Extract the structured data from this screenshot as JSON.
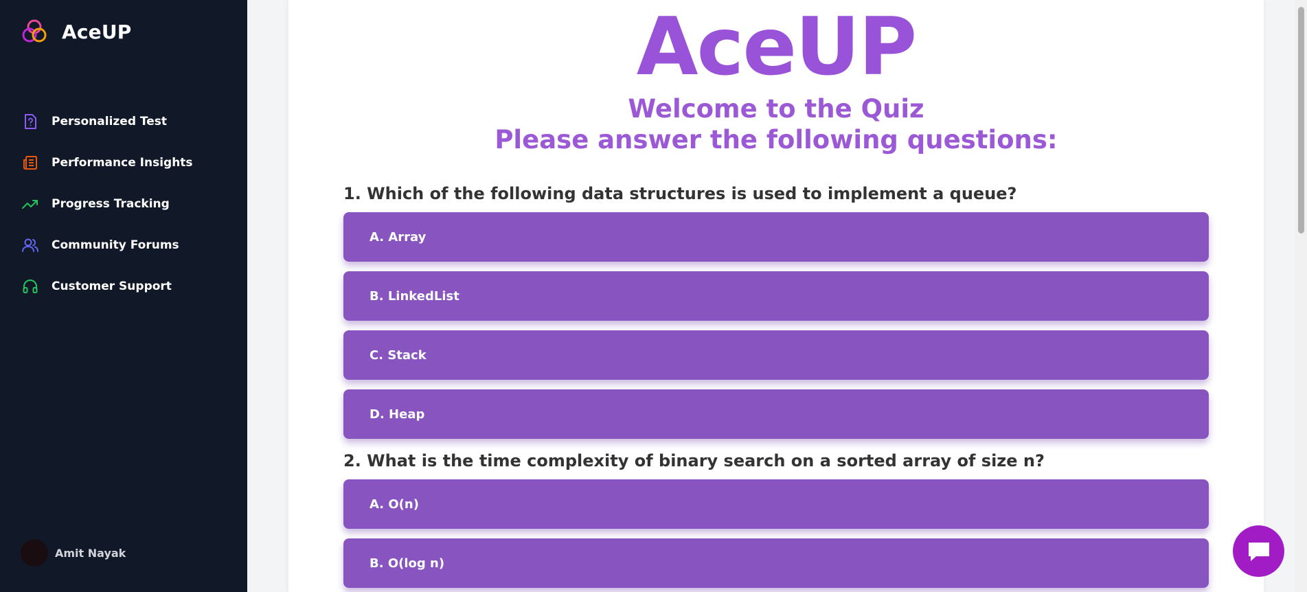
{
  "app": {
    "name": "AceUP"
  },
  "sidebar": {
    "items": [
      {
        "label": "Personalized Test",
        "icon": "question-file-icon",
        "color": "#8b5cf6"
      },
      {
        "label": "Performance Insights",
        "icon": "newspaper-icon",
        "color": "#ea580c"
      },
      {
        "label": "Progress Tracking",
        "icon": "trending-up-icon",
        "color": "#22c55e"
      },
      {
        "label": "Community Forums",
        "icon": "users-icon",
        "color": "#6366f1"
      },
      {
        "label": "Customer Support",
        "icon": "headset-icon",
        "color": "#22c55e"
      }
    ],
    "user": {
      "name": "Amit Nayak"
    }
  },
  "main": {
    "title": "AceUP",
    "subtitle1": "Welcome to the Quiz",
    "subtitle2": "Please answer the following questions:",
    "questions": [
      {
        "text": "1. Which of the following data structures is used to implement a queue?",
        "options": [
          "A. Array",
          "B. LinkedList",
          "C. Stack",
          "D. Heap"
        ]
      },
      {
        "text": "2. What is the time complexity of binary search on a sorted array of size n?",
        "options": [
          "A. O(n)",
          "B. O(log n)"
        ]
      }
    ]
  },
  "colors": {
    "accent": "#8754c0",
    "title": "#9853d9",
    "sidebar_bg": "#111827",
    "chat_button": "#a21cc5"
  }
}
